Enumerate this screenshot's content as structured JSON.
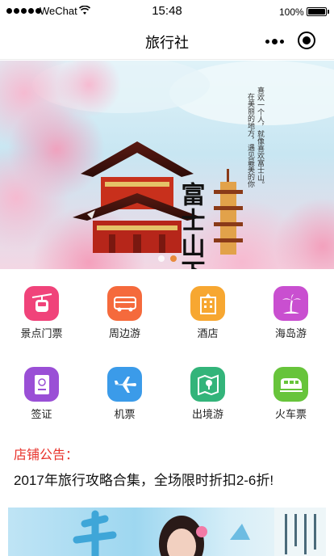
{
  "status_bar": {
    "carrier": "WeChat",
    "time": "15:48",
    "battery": "100%"
  },
  "nav": {
    "title": "旅行社"
  },
  "banner": {
    "headline": "富士山下",
    "tagline_lines": [
      "喜欢一个人，就像喜欢富士山。",
      "在美丽的地方，遇见最美的你"
    ],
    "slide_count": 2,
    "active_slide": 2
  },
  "categories": [
    {
      "label": "景点门票",
      "icon": "cable-car-icon",
      "color": "#f0437a"
    },
    {
      "label": "周边游",
      "icon": "bus-icon",
      "color": "#f56a3c"
    },
    {
      "label": "酒店",
      "icon": "hotel-icon",
      "color": "#f7a731"
    },
    {
      "label": "海岛游",
      "icon": "palm-tree-icon",
      "color": "#c94fd0"
    },
    {
      "label": "签证",
      "icon": "passport-icon",
      "color": "#9a4fd6"
    },
    {
      "label": "机票",
      "icon": "airplane-icon",
      "color": "#3b9be9"
    },
    {
      "label": "出境游",
      "icon": "map-icon",
      "color": "#33b47a"
    },
    {
      "label": "火车票",
      "icon": "train-icon",
      "color": "#67c43b"
    }
  ],
  "notice": {
    "title": "店铺公告：",
    "text": "2017年旅行攻略合集，全场限时折扣2-6折!"
  }
}
